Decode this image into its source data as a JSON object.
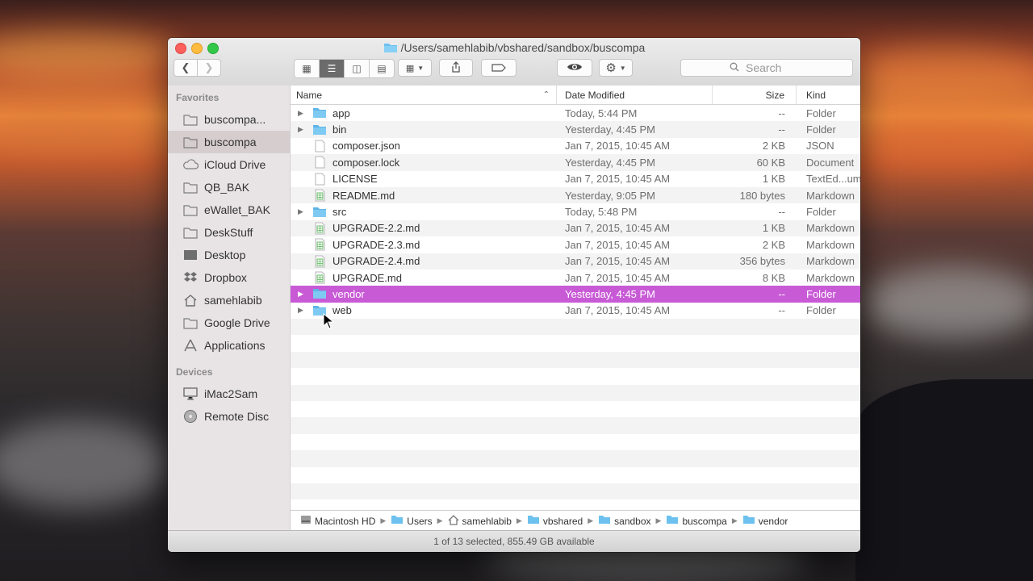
{
  "window": {
    "title_path": "/Users/samehlabib/vbshared/sandbox/buscompa"
  },
  "toolbar": {
    "search_placeholder": "Search"
  },
  "sidebar": {
    "favorites_header": "Favorites",
    "favorites": [
      {
        "label": "buscompa...",
        "icon": "folder-icon",
        "selected": false
      },
      {
        "label": "buscompa",
        "icon": "folder-icon",
        "selected": true
      },
      {
        "label": "iCloud Drive",
        "icon": "cloud-icon",
        "selected": false
      },
      {
        "label": "QB_BAK",
        "icon": "folder-icon",
        "selected": false
      },
      {
        "label": "eWallet_BAK",
        "icon": "folder-icon",
        "selected": false
      },
      {
        "label": "DeskStuff",
        "icon": "folder-icon",
        "selected": false
      },
      {
        "label": "Desktop",
        "icon": "desktop-icon",
        "selected": false
      },
      {
        "label": "Dropbox",
        "icon": "dropbox-icon",
        "selected": false
      },
      {
        "label": "samehlabib",
        "icon": "home-icon",
        "selected": false
      },
      {
        "label": "Google Drive",
        "icon": "folder-icon",
        "selected": false
      },
      {
        "label": "Applications",
        "icon": "applications-icon",
        "selected": false
      }
    ],
    "devices_header": "Devices",
    "devices": [
      {
        "label": "iMac2Sam",
        "icon": "imac-icon"
      },
      {
        "label": "Remote Disc",
        "icon": "disc-icon"
      }
    ]
  },
  "columns": {
    "name": "Name",
    "date": "Date Modified",
    "size": "Size",
    "kind": "Kind"
  },
  "files": [
    {
      "name": "app",
      "date": "Today, 5:44 PM",
      "size": "--",
      "kind": "Folder",
      "type": "folder",
      "selected": false
    },
    {
      "name": "bin",
      "date": "Yesterday, 4:45 PM",
      "size": "--",
      "kind": "Folder",
      "type": "folder",
      "selected": false
    },
    {
      "name": "composer.json",
      "date": "Jan 7, 2015, 10:45 AM",
      "size": "2 KB",
      "kind": "JSON",
      "type": "doc",
      "selected": false
    },
    {
      "name": "composer.lock",
      "date": "Yesterday, 4:45 PM",
      "size": "60 KB",
      "kind": "Document",
      "type": "doc",
      "selected": false
    },
    {
      "name": "LICENSE",
      "date": "Jan 7, 2015, 10:45 AM",
      "size": "1 KB",
      "kind": "TextEd...ument",
      "type": "doc",
      "selected": false
    },
    {
      "name": "README.md",
      "date": "Yesterday, 9:05 PM",
      "size": "180 bytes",
      "kind": "Markdown",
      "type": "md",
      "selected": false
    },
    {
      "name": "src",
      "date": "Today, 5:48 PM",
      "size": "--",
      "kind": "Folder",
      "type": "folder",
      "selected": false
    },
    {
      "name": "UPGRADE-2.2.md",
      "date": "Jan 7, 2015, 10:45 AM",
      "size": "1 KB",
      "kind": "Markdown",
      "type": "md",
      "selected": false
    },
    {
      "name": "UPGRADE-2.3.md",
      "date": "Jan 7, 2015, 10:45 AM",
      "size": "2 KB",
      "kind": "Markdown",
      "type": "md",
      "selected": false
    },
    {
      "name": "UPGRADE-2.4.md",
      "date": "Jan 7, 2015, 10:45 AM",
      "size": "356 bytes",
      "kind": "Markdown",
      "type": "md",
      "selected": false
    },
    {
      "name": "UPGRADE.md",
      "date": "Jan 7, 2015, 10:45 AM",
      "size": "8 KB",
      "kind": "Markdown",
      "type": "md",
      "selected": false
    },
    {
      "name": "vendor",
      "date": "Yesterday, 4:45 PM",
      "size": "--",
      "kind": "Folder",
      "type": "folder",
      "selected": true
    },
    {
      "name": "web",
      "date": "Jan 7, 2015, 10:45 AM",
      "size": "--",
      "kind": "Folder",
      "type": "folder",
      "selected": false
    }
  ],
  "path_bar": [
    {
      "label": "Macintosh HD",
      "icon": "hard-drive-icon"
    },
    {
      "label": "Users",
      "icon": "folder-icon"
    },
    {
      "label": "samehlabib",
      "icon": "home-icon"
    },
    {
      "label": "vbshared",
      "icon": "folder-icon"
    },
    {
      "label": "sandbox",
      "icon": "folder-icon"
    },
    {
      "label": "buscompa",
      "icon": "folder-icon"
    },
    {
      "label": "vendor",
      "icon": "folder-icon"
    }
  ],
  "status": "1 of 13 selected, 855.49 GB available",
  "colors": {
    "selection": "#c85ad6",
    "folder": "#6cc1ef"
  }
}
